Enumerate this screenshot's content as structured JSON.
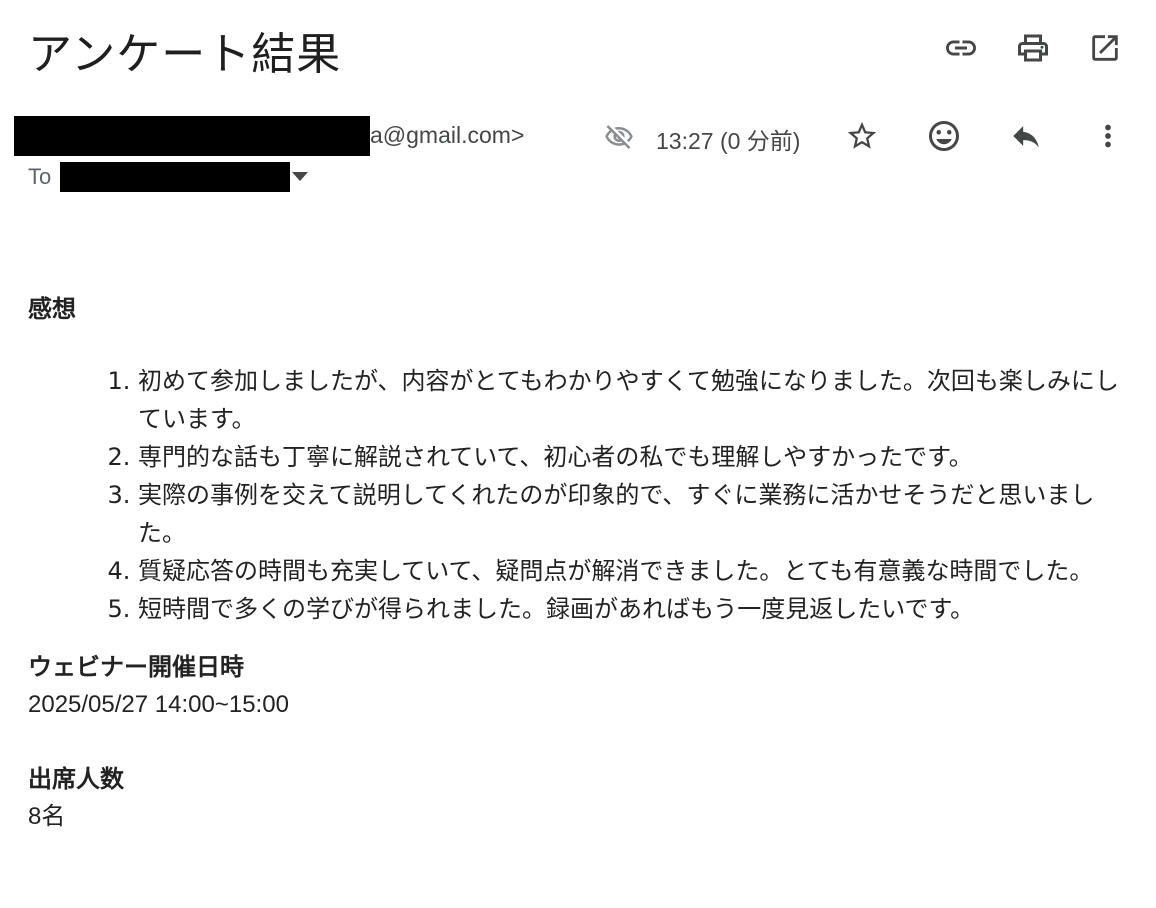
{
  "email": {
    "subject": "アンケート結果",
    "sender_visible_fragment": "a@gmail.com>",
    "time": "13:27 (0 分前)",
    "to_label": "To"
  },
  "icons": {
    "top": [
      "link-icon",
      "print-icon",
      "open-in-new-icon"
    ],
    "row": [
      "hidden-eye-icon",
      "star-icon",
      "emoji-icon",
      "reply-icon",
      "more-vert-icon"
    ]
  },
  "content": {
    "feedback_heading": "感想",
    "feedback_items": [
      "初めて参加しましたが、内容がとてもわかりやすくて勉強になりました。次回も楽しみにしています。",
      "専門的な話も丁寧に解説されていて、初心者の私でも理解しやすかったです。",
      "実際の事例を交えて説明してくれたのが印象的で、すぐに業務に活かせそうだと思いました。",
      "質疑応答の時間も充実していて、疑問点が解消できました。とても有意義な時間でした。",
      "短時間で多くの学びが得られました。録画があればもう一度見返したいです。"
    ],
    "webinar_date_heading": "ウェビナー開催日時",
    "webinar_date_value": "2025/05/27 14:00~15:00",
    "attendance_heading": "出席人数",
    "attendance_value": "8名"
  }
}
